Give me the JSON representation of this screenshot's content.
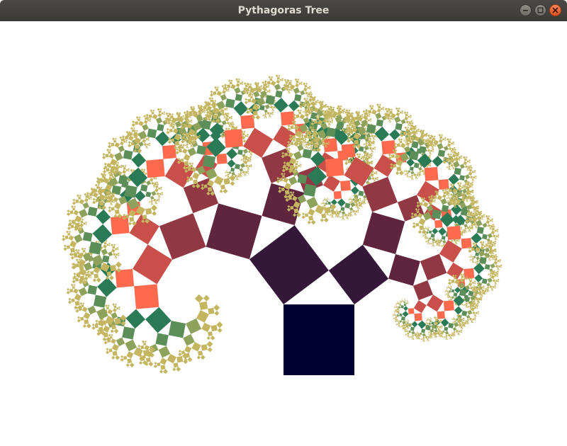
{
  "window": {
    "title": "Pythagoras Tree"
  },
  "controls": {
    "minimize_icon": "minimize-icon",
    "maximize_icon": "maximize-icon",
    "close_icon": "close-icon"
  },
  "fractal": {
    "depth": 11,
    "colors": [
      "#000033",
      "#341739",
      "#5f253f",
      "#923844",
      "#c84f4a",
      "#fd6a4e",
      "#2a7a56",
      "#5b8e58",
      "#8ea25c",
      "#c4b660",
      "#c4b660",
      "#c4b660"
    ]
  }
}
